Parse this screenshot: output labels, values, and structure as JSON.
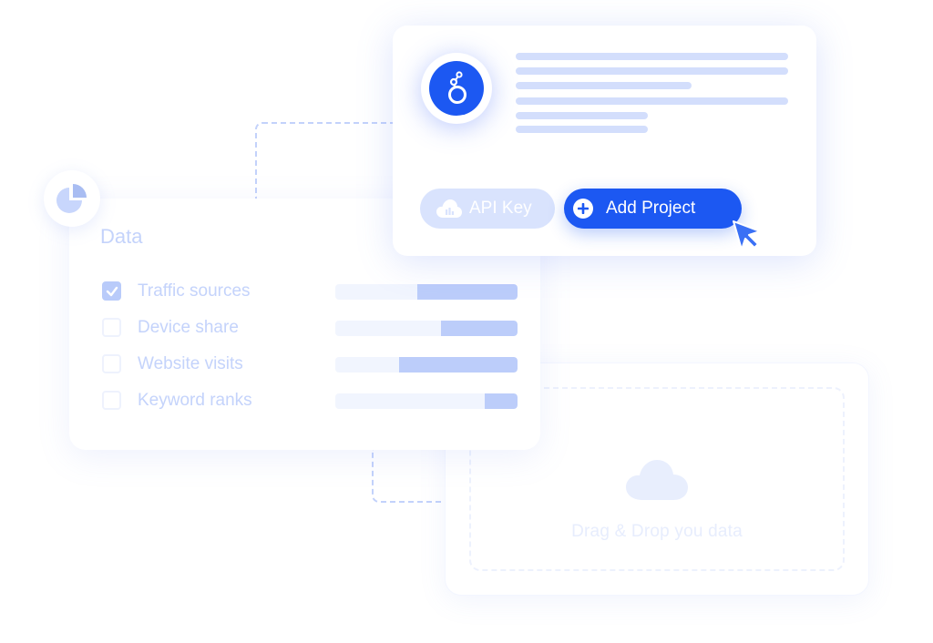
{
  "project_card": {
    "logo": "looker-studio-logo-icon",
    "buttons": {
      "api_key": {
        "label": "API Key",
        "icon": "cloud-chart-icon"
      },
      "add_project": {
        "label": "Add Project",
        "icon": "plus-circle-icon"
      }
    },
    "cursor_icon": "pointer-cursor-icon"
  },
  "data_card": {
    "badge_icon": "pie-chart-icon",
    "title": "Data",
    "rows": [
      {
        "label": "Traffic sources",
        "checked": true,
        "fill_percent": 55
      },
      {
        "label": "Device share",
        "checked": false,
        "fill_percent": 42
      },
      {
        "label": "Website visits",
        "checked": false,
        "fill_percent": 65
      },
      {
        "label": "Keyword ranks",
        "checked": false,
        "fill_percent": 18
      }
    ]
  },
  "drop_card": {
    "icon": "cloud-icon",
    "text": "Drag & Drop you data"
  },
  "colors": {
    "primary": "#1c58f2",
    "muted": "#c4d3fb",
    "bar_fill": "#bccdfa",
    "bar_track": "#f1f5fe",
    "connector": "#c3d2fb"
  }
}
